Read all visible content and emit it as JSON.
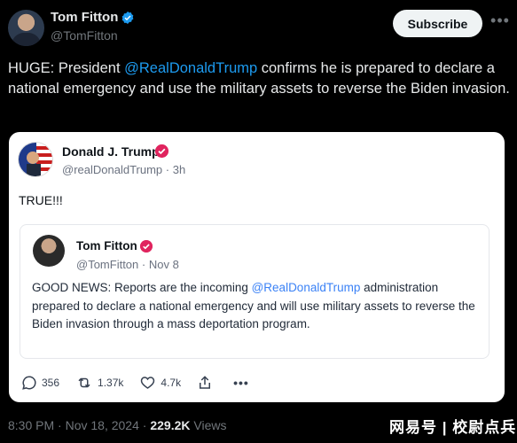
{
  "author": {
    "display_name": "Tom Fitton",
    "handle": "@TomFitton"
  },
  "subscribe_label": "Subscribe",
  "more_label": "•••",
  "tweet": {
    "prefix": "HUGE: President ",
    "mention": "@RealDonaldTrump",
    "suffix": " confirms he is prepared to declare a national emergency and use the military assets to reverse the Biden invasion."
  },
  "embedded_post": {
    "name": "Donald J. Trump",
    "handle": "@realDonaldTrump",
    "time": "3h",
    "text": "TRUE!!!",
    "quote": {
      "name": "Tom Fitton",
      "handle": "@TomFitton",
      "date": "Nov 8",
      "text_prefix": "GOOD NEWS: Reports are the incoming ",
      "mention": "@RealDonaldTrump",
      "text_suffix": " administration prepared to declare a national emergency and will use military assets to reverse the Biden invasion through a mass deportation program."
    },
    "actions": {
      "replies": "356",
      "retruths": "1.37k",
      "likes": "4.7k",
      "more": "•••"
    }
  },
  "footer": {
    "time": "8:30 PM",
    "date": "Nov 18, 2024",
    "views_count": "229.2K",
    "views_label": "Views"
  },
  "watermark": "网易号 | 校尉点兵",
  "colors": {
    "background": "#000000",
    "mention": "#1d9bf0",
    "verified": "#1d9bf0",
    "truth_badge": "#e0245e"
  },
  "icons": [
    "verified-badge-icon",
    "reply-icon",
    "retruth-icon",
    "heart-icon",
    "share-icon",
    "more-icon"
  ]
}
